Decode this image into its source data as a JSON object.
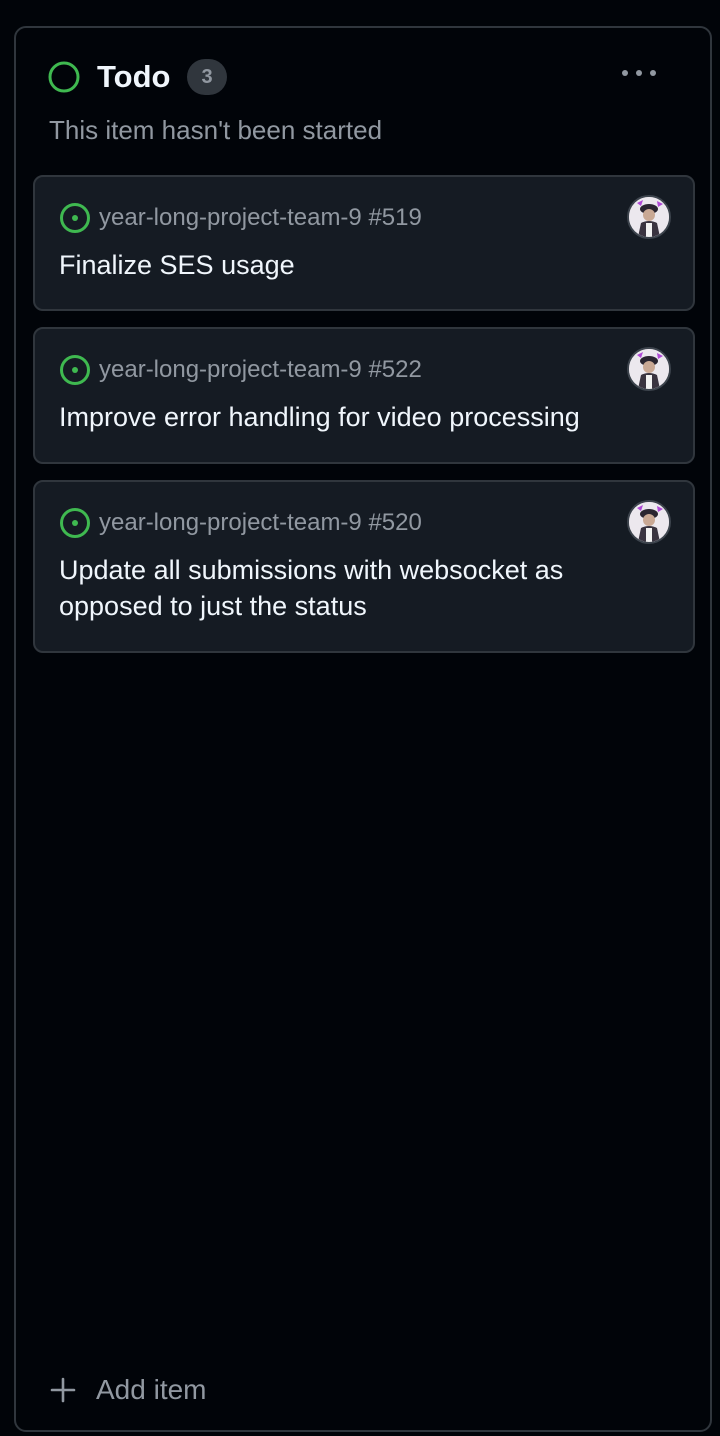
{
  "column": {
    "title": "Todo",
    "count": "3",
    "subtitle": "This item hasn't been started",
    "status_color": "#3fb950"
  },
  "cards": [
    {
      "meta": "year-long-project-team-9 #519",
      "title": "Finalize SES usage",
      "icon": "issue-open-icon",
      "avatar": "user-avatar"
    },
    {
      "meta": "year-long-project-team-9 #522",
      "title": "Improve error handling for video processing",
      "icon": "issue-open-icon",
      "avatar": "user-avatar"
    },
    {
      "meta": "year-long-project-team-9 #520",
      "title": "Update all submissions with websocket as opposed to just the status",
      "icon": "issue-open-icon",
      "avatar": "user-avatar"
    }
  ],
  "footer": {
    "add_label": "Add item",
    "add_icon": "plus-icon"
  },
  "colors": {
    "background": "#010409",
    "card_background": "#151b23",
    "border": "#30363d",
    "text_primary": "#f0f6fc",
    "text_muted": "#9198a1",
    "open_green": "#3fb950"
  }
}
